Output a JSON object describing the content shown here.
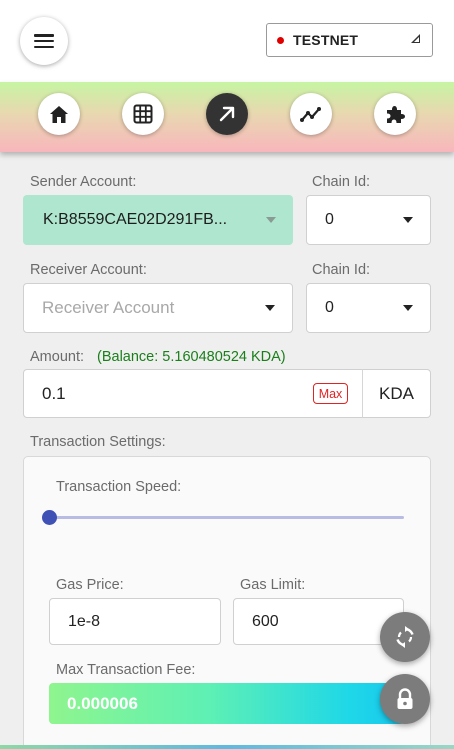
{
  "header": {
    "network": {
      "label": "TESTNET",
      "status_color": "#e00000"
    }
  },
  "nav": {
    "items": [
      {
        "icon": "home-icon"
      },
      {
        "icon": "grid-icon"
      },
      {
        "icon": "send-arrow-icon",
        "active": true
      },
      {
        "icon": "chart-line-icon"
      },
      {
        "icon": "puzzle-icon"
      }
    ]
  },
  "form": {
    "sender_label": "Sender Account:",
    "sender_value": "K:B8559CAE02D291FB...",
    "sender_chain_label": "Chain Id:",
    "sender_chain_value": "0",
    "receiver_label": "Receiver Account:",
    "receiver_placeholder": "Receiver Account",
    "receiver_chain_label": "Chain Id:",
    "receiver_chain_value": "0",
    "amount_label": "Amount:",
    "balance_text": "(Balance: 5.160480524 KDA)",
    "amount_value": "0.1",
    "max_label": "Max",
    "unit": "KDA"
  },
  "settings": {
    "title": "Transaction Settings:",
    "speed_label": "Transaction Speed:",
    "speed_level": 0,
    "gas_price_label": "Gas Price:",
    "gas_price_value": "1e-8",
    "gas_limit_label": "Gas Limit:",
    "gas_limit_value": "600",
    "max_fee_label": "Max Transaction Fee:",
    "max_fee_value": "0.000006"
  },
  "colors": {
    "accent": "#3f51b5",
    "sender_bg": "#aee6cf",
    "balance_text": "#1a7f1a",
    "max_badge": "#e02424"
  }
}
